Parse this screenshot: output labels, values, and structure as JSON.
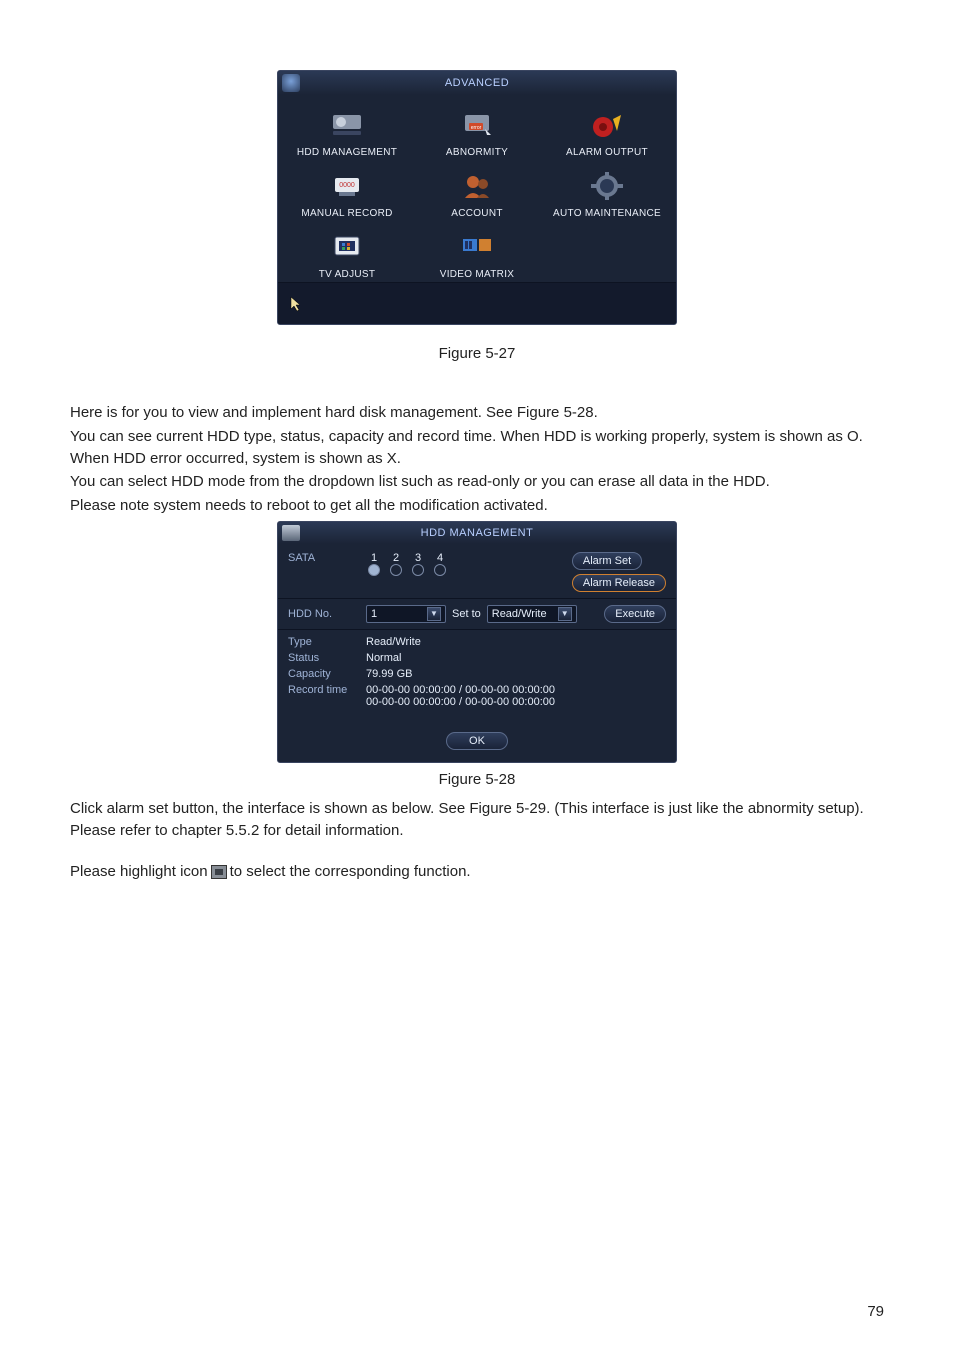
{
  "figure1": {
    "title": "ADVANCED",
    "caption": "Figure 5-27",
    "items": [
      {
        "label": "HDD MANAGEMENT",
        "icon": "hdd-icon"
      },
      {
        "label": "ABNORMITY",
        "icon": "abnormity-icon"
      },
      {
        "label": "ALARM OUTPUT",
        "icon": "alarm-icon"
      },
      {
        "label": "MANUAL RECORD",
        "icon": "manual-record-icon"
      },
      {
        "label": "ACCOUNT",
        "icon": "account-icon"
      },
      {
        "label": "AUTO MAINTENANCE",
        "icon": "auto-maint-icon"
      },
      {
        "label": "TV ADJUST",
        "icon": "tv-adjust-icon"
      },
      {
        "label": "VIDEO MATRIX",
        "icon": "video-matrix-icon"
      }
    ]
  },
  "paragraphs": {
    "p1": "Here is for you to view and implement hard disk management. See Figure 5-28.",
    "p2": "You can see current HDD type, status, capacity and record time. When HDD is working properly, system is shown as O. When HDD error occurred, system is shown as X.",
    "p3": "You can select HDD mode from the dropdown list such as read-only or you can erase all data in the HDD.",
    "p4": "Please note system needs to reboot to get all the modification activated.",
    "p5": "Click alarm set button, the interface is shown as below. See Figure 5-29. (This interface is just like the abnormity setup). Please refer to chapter 5.5.2 for detail information.",
    "p6a": "Please highlight icon ",
    "p6b": " to select the corresponding function."
  },
  "figure2": {
    "title": "HDD MANAGEMENT",
    "caption": "Figure 5-28",
    "sata_label": "SATA",
    "sata_numbers": [
      "1",
      "2",
      "3",
      "4"
    ],
    "alarm_set": "Alarm Set",
    "alarm_release": "Alarm Release",
    "hdd_no_label": "HDD No.",
    "hdd_no_value": "1",
    "set_to_label": "Set to",
    "set_to_value": "Read/Write",
    "execute": "Execute",
    "type_label": "Type",
    "type_value": "Read/Write",
    "status_label": "Status",
    "status_value": "Normal",
    "capacity_label": "Capacity",
    "capacity_value": "79.99 GB",
    "record_time_label": "Record time",
    "record_time_line1": "00-00-00 00:00:00 / 00-00-00 00:00:00",
    "record_time_line2": "00-00-00 00:00:00 / 00-00-00 00:00:00",
    "ok": "OK"
  },
  "page_number": "79"
}
